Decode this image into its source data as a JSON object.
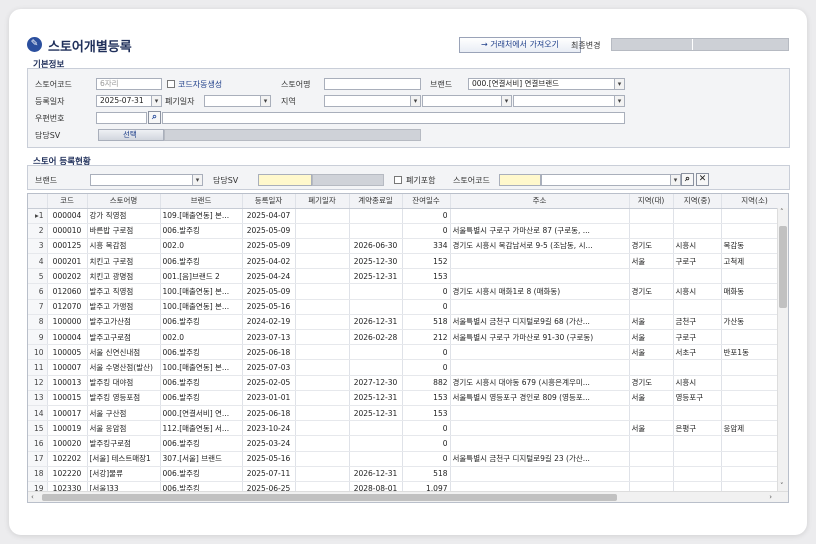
{
  "title": "스토어개별등록",
  "import_button": "→ 거래처에서 가져오기",
  "last_modified_label": "최종변경",
  "basic": {
    "section_label": "기본정보",
    "store_code_label": "스토어코드",
    "store_code_placeholder": "6자리",
    "auto_code_label": "코드자동생성",
    "store_name_label": "스토어명",
    "brand_label": "브랜드",
    "brand_value": "000.[연결서비] 연결브랜드",
    "reg_date_label": "등록일자",
    "reg_date_value": "2025-07-31",
    "close_date_label": "폐기일자",
    "region_label": "지역",
    "zip_label": "우편번호",
    "sv_label": "담당SV",
    "sv_button": "선택"
  },
  "status": {
    "section_label": "스토어 등록현황",
    "brand_label": "브랜드",
    "sv_label": "담당SV",
    "include_closed_label": "폐기포함",
    "store_code_label": "스토어코드"
  },
  "grid": {
    "columns": [
      "",
      "코드",
      "스토어명",
      "브랜드",
      "등록일자",
      "폐기일자",
      "계약종료일",
      "잔여일수",
      "주소",
      "지역(대)",
      "지역(중)",
      "지역(소)"
    ],
    "rows": [
      [
        "▸1",
        "000004",
        "강가 직영점",
        "109.[매출연동] 본...",
        "2025-04-07",
        "",
        "",
        "0",
        "",
        "",
        "",
        ""
      ],
      [
        "2",
        "000010",
        "바른밥 구로점",
        "006.발주킹",
        "2025-05-09",
        "",
        "",
        "0",
        "서울특별시 구로구 가마산로 87 (구로동, ...",
        "",
        "",
        ""
      ],
      [
        "3",
        "000125",
        "시흥 목감점",
        "002.0",
        "2025-05-09",
        "",
        "2026-06-30",
        "334",
        "경기도 시흥시 목감남서로 9-5 (조남동, 시...",
        "경기도",
        "시흥시",
        "목감동"
      ],
      [
        "4",
        "000201",
        "치킨고 구로점",
        "006.발주킹",
        "2025-04-02",
        "",
        "2025-12-30",
        "152",
        "",
        "서울",
        "구로구",
        "고척제"
      ],
      [
        "5",
        "000202",
        "치킨고 광명점",
        "001.[음]브랜드 2",
        "2025-04-24",
        "",
        "2025-12-31",
        "153",
        "",
        "",
        "",
        ""
      ],
      [
        "6",
        "012060",
        "발주고 직영점",
        "100.[매출연동] 본...",
        "2025-05-09",
        "",
        "",
        "0",
        "경기도 시흥시 매화1로 8 (매화동)",
        "경기도",
        "시흥시",
        "매화동"
      ],
      [
        "7",
        "012070",
        "발주고 가맹점",
        "100.[매출연동] 본...",
        "2025-05-16",
        "",
        "",
        "0",
        "",
        "",
        "",
        ""
      ],
      [
        "8",
        "100000",
        "발주고가산점",
        "006.발주킹",
        "2024-02-19",
        "",
        "2026-12-31",
        "518",
        "서울특별시 금천구 디지털로9길 68 (가산...",
        "서울",
        "금천구",
        "가산동"
      ],
      [
        "9",
        "100004",
        "발주고구로점",
        "002.0",
        "2023-07-13",
        "",
        "2026-02-28",
        "212",
        "서울특별시 구로구 가마산로 91-30 (구로동)",
        "서울",
        "구로구",
        ""
      ],
      [
        "10",
        "100005",
        "서울 신연신내점",
        "006.발주킹",
        "2025-06-18",
        "",
        "",
        "0",
        "",
        "서울",
        "서초구",
        "반포1동"
      ],
      [
        "11",
        "100007",
        "서울 수명산점(발산)",
        "100.[매출연동] 본...",
        "2025-07-03",
        "",
        "",
        "0",
        "",
        "",
        "",
        ""
      ],
      [
        "12",
        "100013",
        "발주킹 대야점",
        "006.발주킹",
        "2025-02-05",
        "",
        "2027-12-30",
        "882",
        "경기도 시흥시 대야동 679 (시흥은계우미...",
        "경기도",
        "시흥시",
        ""
      ],
      [
        "13",
        "100015",
        "발주킹 영등포점",
        "006.발주킹",
        "2023-01-01",
        "",
        "2025-12-31",
        "153",
        "서울특별시 영등포구 경인로 809 (영등포...",
        "서울",
        "영등포구",
        ""
      ],
      [
        "14",
        "100017",
        "서울 구산점",
        "000.[연결서비] 연...",
        "2025-06-18",
        "",
        "2025-12-31",
        "153",
        "",
        "",
        "",
        ""
      ],
      [
        "15",
        "100019",
        "서울 응암점",
        "112.[매출연동] 서...",
        "2023-10-24",
        "",
        "",
        "0",
        "",
        "서울",
        "은평구",
        "응암제"
      ],
      [
        "16",
        "100020",
        "발주킹구로점",
        "006.발주킹",
        "2025-03-24",
        "",
        "",
        "0",
        "",
        "",
        "",
        ""
      ],
      [
        "17",
        "102202",
        "[서울] 테스트매장1",
        "307.[서울] 브랜드",
        "2025-05-16",
        "",
        "",
        "0",
        "서울특별시 금천구 디지털로9길 23 (가산...",
        "",
        "",
        ""
      ],
      [
        "18",
        "102220",
        "[서강]물류",
        "006.발주킹",
        "2025-07-11",
        "",
        "2026-12-31",
        "518",
        "",
        "",
        "",
        ""
      ],
      [
        "19",
        "102330",
        "[서울]33",
        "006.발주킹",
        "2025-06-25",
        "",
        "2028-08-01",
        "1,097",
        "",
        "",
        "",
        ""
      ]
    ]
  }
}
